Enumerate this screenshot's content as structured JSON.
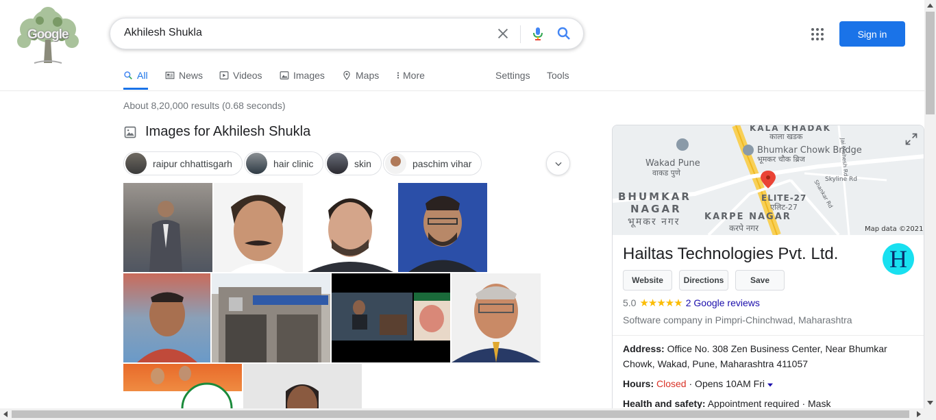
{
  "search": {
    "query": "Akhilesh Shukla"
  },
  "logo": {
    "text": "Google"
  },
  "header": {
    "signin_label": "Sign in"
  },
  "tabs": [
    {
      "label": "All",
      "icon": "search-icon",
      "active": true
    },
    {
      "label": "News",
      "icon": "news-icon"
    },
    {
      "label": "Videos",
      "icon": "video-icon"
    },
    {
      "label": "Images",
      "icon": "image-icon"
    },
    {
      "label": "Maps",
      "icon": "map-pin-icon"
    },
    {
      "label": "More",
      "icon": "more-vert-icon"
    }
  ],
  "tools": {
    "settings": "Settings",
    "tools": "Tools"
  },
  "results": {
    "stats": "About 8,20,000 results (0.68 seconds)",
    "images_header": "Images for Akhilesh Shukla",
    "chips": [
      "raipur chhattisgarh",
      "hair clinic",
      "skin",
      "paschim vihar"
    ]
  },
  "knowledge_panel": {
    "map": {
      "labels": [
        "KALA KHADAK",
        "काला खडक",
        "Bhumkar Chowk Bridge",
        "भूमकर चौक ब्रिज",
        "Wakad Pune",
        "वाकड पुणे",
        "BHUMKAR",
        "NAGAR",
        "भूमकर नगर",
        "ELITE-27",
        "एलिट-27",
        "KARPE NAGAR",
        "करपे नगर",
        "Skyline Rd",
        "Jai Mahesh Rd",
        "Shankar Rd"
      ],
      "attribution": "Map data ©2021"
    },
    "title": "Hailtas Technologies Pvt. Ltd.",
    "logo_letter": "H",
    "buttons": [
      "Website",
      "Directions",
      "Save"
    ],
    "rating": "5.0",
    "stars": "★★★★★",
    "reviews": "2 Google reviews",
    "category": "Software company in Pimpri-Chinchwad, Maharashtra",
    "address_label": "Address:",
    "address": "Office No. 308 Zen Business Center, Near Bhumkar Chowk, Wakad, Pune, Maharashtra 411057",
    "hours_label": "Hours:",
    "hours_status": "Closed",
    "hours_detail": " · Opens 10AM Fri",
    "health_label": "Health and safety:",
    "health": "Appointment required · Mask"
  },
  "colors": {
    "accent": "#1a73e8",
    "link": "#1a0dab",
    "closed": "#d93025",
    "star": "#fbbc04"
  }
}
